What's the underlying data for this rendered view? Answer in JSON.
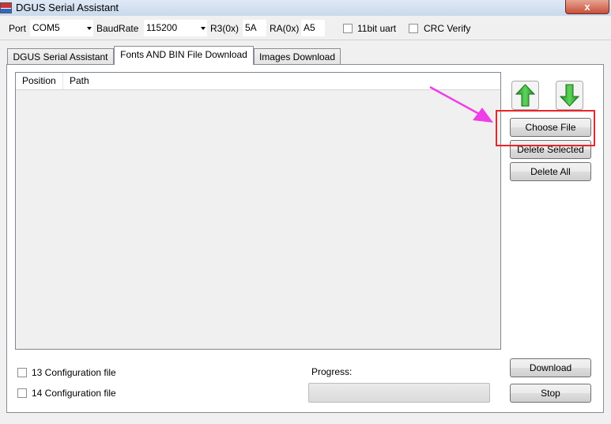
{
  "window": {
    "title": "DGUS Serial Assistant",
    "close_label": "x"
  },
  "toolbar": {
    "port_label": "Port",
    "port_value": "COM5",
    "baud_label": "BaudRate",
    "baud_value": "115200",
    "r3_label": "R3(0x)",
    "r3_value": "5A",
    "ra_label": "RA(0x)",
    "ra_value": "A5",
    "uart11_label": "11bit uart",
    "uart11_checked": false,
    "crc_label": "CRC Verify",
    "crc_checked": false
  },
  "tabs": [
    {
      "label": "DGUS Serial Assistant",
      "active": false
    },
    {
      "label": "Fonts AND BIN File Download",
      "active": true
    },
    {
      "label": "Images Download",
      "active": false
    }
  ],
  "file_list": {
    "columns": [
      "Position",
      "Path"
    ],
    "rows": []
  },
  "buttons": {
    "move_up": "up-arrow",
    "move_down": "down-arrow",
    "choose_file": "Choose File",
    "delete_selected": "Delete Selected",
    "delete_all": "Delete All",
    "download": "Download",
    "stop": "Stop"
  },
  "options": {
    "config13_label": "13 Configuration file",
    "config13_checked": false,
    "config14_label": "14 Configuration file",
    "config14_checked": false
  },
  "progress": {
    "label": "Progress:",
    "value": 0
  },
  "annotation": {
    "arrow_color": "#ee3ee8",
    "box_color": "#e8262c"
  },
  "colors": {
    "up_arrow": "#2fb22f",
    "down_arrow": "#2fb22f"
  }
}
